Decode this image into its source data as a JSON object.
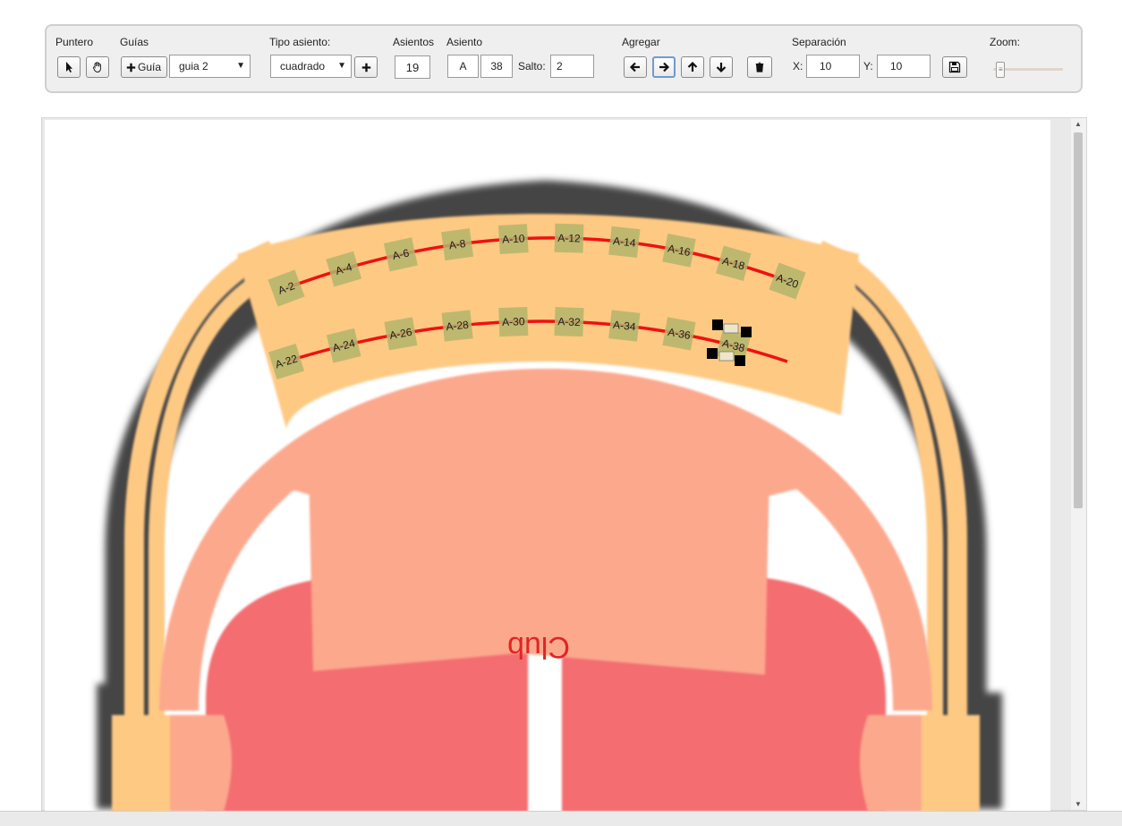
{
  "toolbar": {
    "puntero": {
      "label": "Puntero",
      "select_icon": "pointer-arrow-icon",
      "hand_icon": "hand-pan-icon"
    },
    "guias": {
      "label": "Guías",
      "add_button": "Guía",
      "selected": "guia 2"
    },
    "tipo_asiento": {
      "label": "Tipo asiento:",
      "selected": "cuadrado",
      "add_icon": "plus-icon"
    },
    "asientos": {
      "label": "Asientos",
      "value": "19"
    },
    "asiento": {
      "label": "Asiento",
      "row": "A",
      "number": "38",
      "salto_label": "Salto:",
      "salto": "2"
    },
    "agregar": {
      "label": "Agregar",
      "left_icon": "arrow-left-icon",
      "right_icon": "arrow-right-icon",
      "up_icon": "arrow-up-icon",
      "down_icon": "arrow-down-icon",
      "active": "right",
      "trash_icon": "trash-icon"
    },
    "separacion": {
      "label": "Separación",
      "x_label": "X:",
      "x": "10",
      "y_label": "Y:",
      "y": "10",
      "save_icon": "floppy-save-icon"
    },
    "zoom": {
      "label": "Zoom:",
      "level": 0.05
    }
  },
  "map": {
    "club_label": "Club",
    "colors": {
      "upper_section": "#fec983",
      "mid_section": "#fca88d",
      "lower_section": "#f46d70",
      "shadow": "#444444",
      "seat": "#b3b56c",
      "guide": "#ee1111"
    },
    "rows": [
      {
        "seats": [
          "A-2",
          "A-4",
          "A-6",
          "A-8",
          "A-10",
          "A-12",
          "A-14",
          "A-16",
          "A-18",
          "A-20"
        ]
      },
      {
        "seats": [
          "A-22",
          "A-24",
          "A-26",
          "A-28",
          "A-30",
          "A-32",
          "A-34",
          "A-36",
          "A-38"
        ]
      }
    ]
  }
}
